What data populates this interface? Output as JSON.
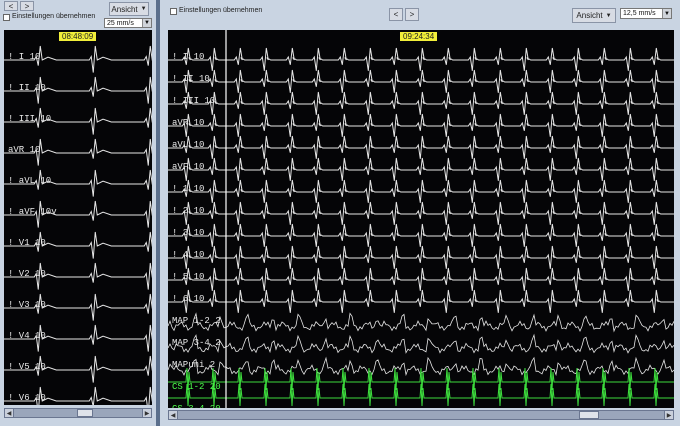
{
  "left": {
    "nav_prev": "<",
    "nav_next": ">",
    "checkbox_label": "Einstellungen übernehmen",
    "view_button": "Ansicht",
    "speed_value": "25 mm/s",
    "timestamp": "08:48:09",
    "channels": [
      "! I 10",
      "! II 10",
      "! III 10",
      "aVR 10",
      "! aVL 10",
      "! aVF 10v",
      "! V1 10",
      "! V2 10",
      "! V3 10",
      "! V4 10",
      "! V5 10",
      "! V6 10"
    ]
  },
  "right": {
    "checkbox_label": "Einstellungen übernehmen",
    "nav_prev": "<",
    "nav_next": ">",
    "view_button": "Ansicht",
    "speed_value": "12,5 mm/s",
    "timestamp": "09:24:34",
    "channels": [
      "! I 10",
      "! II 10",
      "! III 10",
      "aVR 10",
      "aVL 10",
      "aVF 10",
      "! 1 10",
      "! 2 10",
      "! 3 10",
      "! 4 10",
      "! 5 10",
      "! 6 10",
      "MAP 1-2 2",
      "MAP 3-4 2",
      "MAPuni 2",
      "CS 1-2 20",
      "CS 3-4 20"
    ]
  },
  "icons": [
    "left-arrow-icon",
    "right-arrow-icon",
    "chevron-down-icon",
    "checkbox-icon"
  ],
  "colors": {
    "ecg_trace": "#e6e6e6",
    "cs_trace": "#3ddc3d",
    "timestamp_bg": "#f2ef3a",
    "panel_bg": "#c9d4e2",
    "screen_bg": "#050507"
  }
}
